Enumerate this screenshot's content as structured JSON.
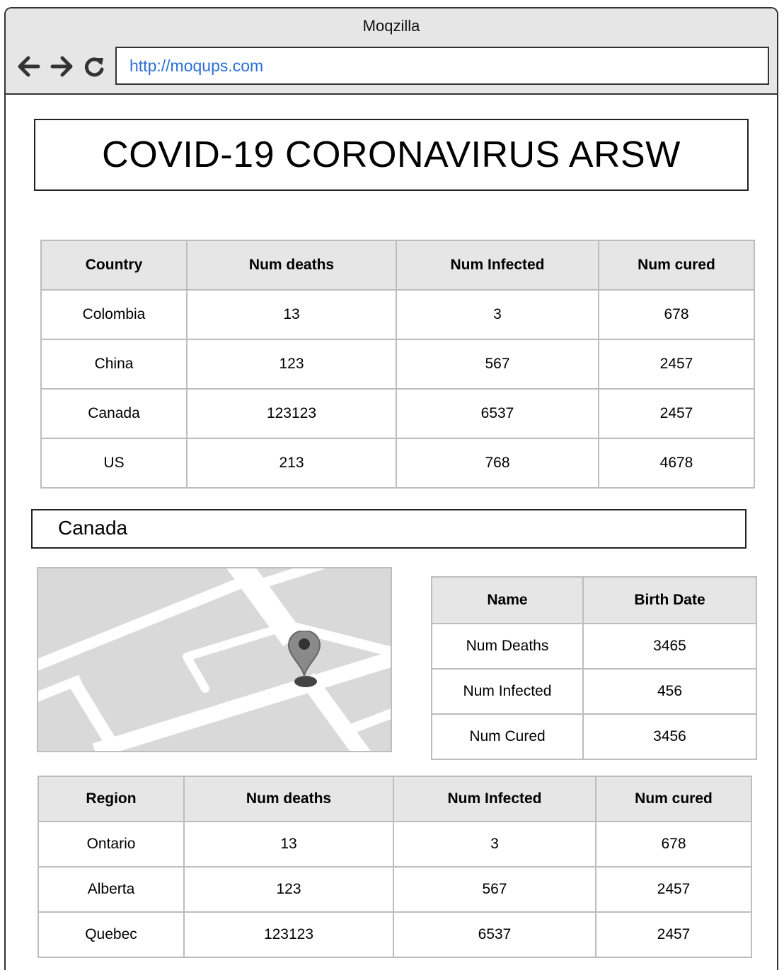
{
  "browser": {
    "title": "Moqzilla",
    "url": "http://moqups.com",
    "back_icon": "back-arrow-icon",
    "forward_icon": "forward-arrow-icon",
    "reload_icon": "reload-icon"
  },
  "page": {
    "title": "COVID-19 CORONAVIRUS ARSW",
    "selected_country": "Canada"
  },
  "countries_table": {
    "headers": [
      "Country",
      "Num deaths",
      "Num Infected",
      "Num cured"
    ],
    "rows": [
      [
        "Colombia",
        "13",
        "3",
        "678"
      ],
      [
        "China",
        "123",
        "567",
        "2457"
      ],
      [
        "Canada",
        "123123",
        "6537",
        "2457"
      ],
      [
        "US",
        "213",
        "768",
        "4678"
      ]
    ]
  },
  "map": {
    "icon": "map-pin-icon"
  },
  "stats_table": {
    "headers": [
      "Name",
      "Birth Date"
    ],
    "rows": [
      [
        "Num Deaths",
        "3465"
      ],
      [
        "Num Infected",
        "456"
      ],
      [
        "Num Cured",
        "3456"
      ]
    ]
  },
  "regions_table": {
    "headers": [
      "Region",
      "Num deaths",
      "Num Infected",
      "Num cured"
    ],
    "rows": [
      [
        "Ontario",
        "13",
        "3",
        "678"
      ],
      [
        "Alberta",
        "123",
        "567",
        "2457"
      ],
      [
        "Quebec",
        "123123",
        "6537",
        "2457"
      ]
    ]
  }
}
